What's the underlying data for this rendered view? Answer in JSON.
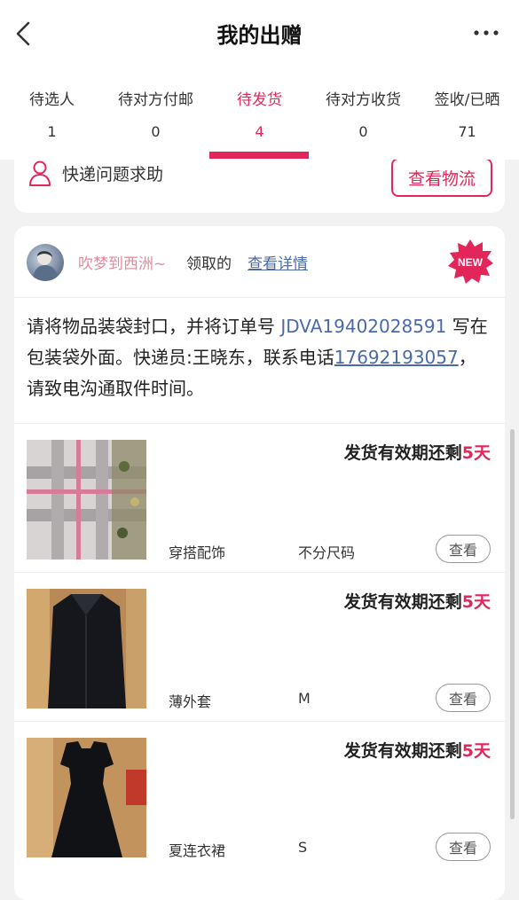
{
  "header": {
    "title": "我的出赠"
  },
  "tabs": [
    {
      "label": "待选人",
      "count": "1"
    },
    {
      "label": "待对方付邮",
      "count": "0"
    },
    {
      "label": "待发货",
      "count": "4"
    },
    {
      "label": "待对方收货",
      "count": "0"
    },
    {
      "label": "签收/已晒",
      "count": "71"
    }
  ],
  "active_tab": "待发货",
  "help_card": {
    "help_label": "快递问题求助",
    "logistics_button": "查看物流"
  },
  "order_card": {
    "claimer_name": "吹梦到西洲~",
    "claimed_text": "领取的",
    "detail_link": "查看详情",
    "new_badge": "NEW",
    "instructions": {
      "part1": "请将物品装袋封口，并将订单号 ",
      "order_no": "JDVA19402028591",
      "part2": " 写在包装袋外面。快递员:王晓东，联系电话",
      "phone": "17692193057",
      "part3": "，请致电沟通取件时间。"
    },
    "items": [
      {
        "deadline_prefix": "发货有效期还剩",
        "days": "5天",
        "name": "穿搭配饰",
        "size": "不分尺码",
        "view_label": "查看"
      },
      {
        "deadline_prefix": "发货有效期还剩",
        "days": "5天",
        "name": "薄外套",
        "size": "M",
        "view_label": "查看"
      },
      {
        "deadline_prefix": "发货有效期还剩",
        "days": "5天",
        "name": "夏连衣裙",
        "size": "S",
        "view_label": "查看"
      }
    ]
  },
  "colors": {
    "accent": "#e2265a",
    "link": "#4b6aa8",
    "claimer_name": "#e78a9b"
  },
  "icons": [
    "back-arrow-icon",
    "more-dots-icon",
    "user-icon",
    "new-burst-icon"
  ]
}
